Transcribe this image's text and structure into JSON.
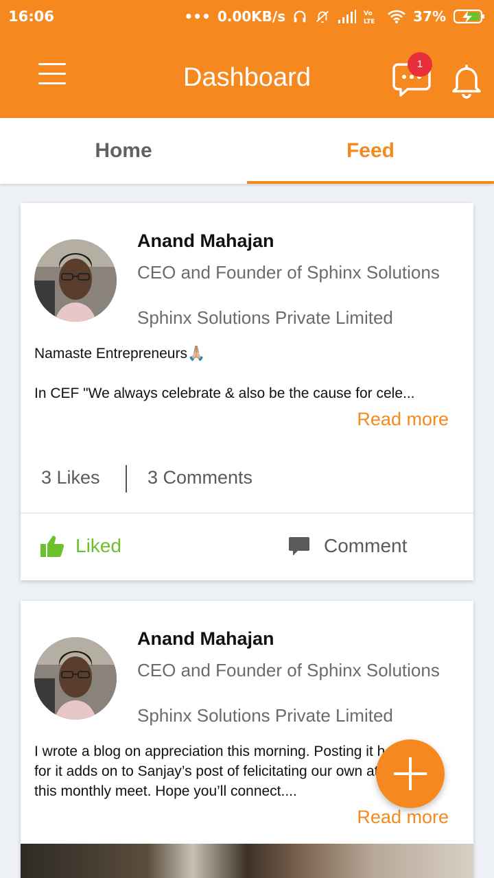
{
  "status_bar": {
    "time": "16:06",
    "network_speed": "0.00KB/s",
    "battery": "37%",
    "icons": [
      "headphones-icon",
      "mute-vibrate-icon",
      "signal-icon",
      "volte-icon",
      "wifi-icon",
      "battery-charging-icon"
    ]
  },
  "app_bar": {
    "title": "Dashboard",
    "chat_badge": "1",
    "icons": [
      "menu-icon",
      "chat-icon",
      "bell-icon"
    ]
  },
  "tabs": [
    {
      "label": "Home",
      "selected": false
    },
    {
      "label": "Feed",
      "selected": true
    }
  ],
  "colors": {
    "brand": "#f5891f",
    "liked": "#6cc02c",
    "badge": "#e8303a",
    "background": "#eef1f5"
  },
  "posts": [
    {
      "author": "Anand Mahajan",
      "role": "CEO and Founder of Sphinx Solutions",
      "company": "Sphinx Solutions Private Limited",
      "text_line1": "Namaste Entrepreneurs🙏🏼",
      "text_line2": "In CEF \"We always celebrate & also be the cause for cele...",
      "read_more": "Read more",
      "likes": "3 Likes",
      "comments": "3 Comments",
      "like_label": "Liked",
      "comment_label": "Comment"
    },
    {
      "author": "Anand Mahajan",
      "role": "CEO and Founder of Sphinx Solutions",
      "company": "Sphinx Solutions Private Limited",
      "text_line1": "I wrote a blog on appreciation this morning. Posting it here",
      "text_line2": "for it adds on to Sanjay’s post of felicitating our own at",
      "text_line3": "this monthly meet. Hope you’ll connect....",
      "read_more": "Read more"
    }
  ],
  "fab_icon": "plus-icon"
}
